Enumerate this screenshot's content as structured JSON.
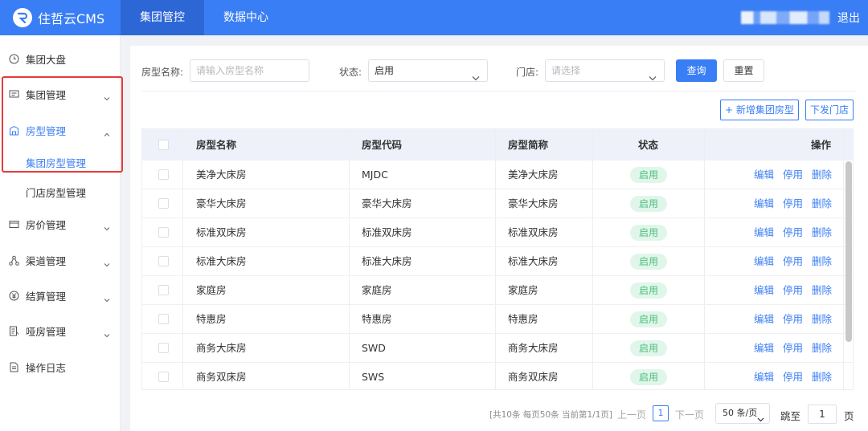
{
  "header": {
    "app_title": "住哲云CMS",
    "tabs": [
      {
        "label": "集团管控",
        "active": true
      },
      {
        "label": "数据中心",
        "active": false
      }
    ],
    "logout_label": "退出"
  },
  "sidebar": {
    "items": [
      {
        "label": "集团大盘",
        "icon": "clock-icon"
      },
      {
        "label": "集团管理",
        "icon": "message-icon"
      },
      {
        "label": "房型管理",
        "icon": "building-icon",
        "expanded": true,
        "children": [
          {
            "label": "集团房型管理",
            "active": true
          },
          {
            "label": "门店房型管理",
            "active": false
          }
        ]
      },
      {
        "label": "房价管理",
        "icon": "card-icon"
      },
      {
        "label": "渠道管理",
        "icon": "network-icon"
      },
      {
        "label": "结算管理",
        "icon": "yen-icon"
      },
      {
        "label": "哑房管理",
        "icon": "list-icon"
      },
      {
        "label": "操作日志",
        "icon": "document-icon"
      }
    ]
  },
  "filters": {
    "room_type_label": "房型名称:",
    "room_type_placeholder": "请输入房型名称",
    "status_label": "状态:",
    "status_value": "启用",
    "store_label": "门店:",
    "store_placeholder": "请选择",
    "query_label": "查询",
    "reset_label": "重置"
  },
  "actions": {
    "add_label": "+ 新增集团房型",
    "dispatch_label": "下发门店"
  },
  "table": {
    "headers": [
      "房型名称",
      "房型代码",
      "房型简称",
      "状态",
      "操作"
    ],
    "rows": [
      [
        "美净大床房",
        "MJDC",
        "美净大床房",
        "启用"
      ],
      [
        "豪华大床房",
        "豪华大床房",
        "豪华大床房",
        "启用"
      ],
      [
        "标准双床房",
        "标准双床房",
        "标准双床房",
        "启用"
      ],
      [
        "标准大床房",
        "标准大床房",
        "标准大床房",
        "启用"
      ],
      [
        "家庭房",
        "家庭房",
        "家庭房",
        "启用"
      ],
      [
        "特惠房",
        "特惠房",
        "特惠房",
        "启用"
      ],
      [
        "商务大床房",
        "SWD",
        "商务大床房",
        "启用"
      ],
      [
        "商务双床房",
        "SWS",
        "商务双床房",
        "启用"
      ]
    ],
    "ops": [
      "编辑",
      "停用",
      "删除"
    ]
  },
  "pagination": {
    "info": "[共10条 每页50条 当前第1/1页]",
    "prev_label": "上一页",
    "current_page": "1",
    "next_label": "下一页",
    "page_size": "50 条/页",
    "jump_label": "跳至",
    "jump_value": "1",
    "page_suffix": "页"
  },
  "colors": {
    "primary": "#3a7ef5",
    "status_enabled_bg": "#e1f6ea",
    "status_enabled_text": "#4cbf7f",
    "highlight_border": "#e83a3a"
  }
}
